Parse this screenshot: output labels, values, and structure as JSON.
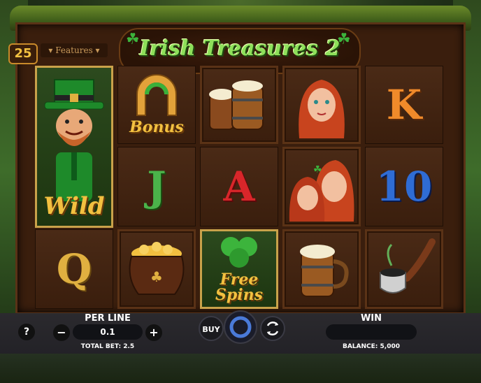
{
  "game": {
    "title": "Irish Treasures 2",
    "lines": "25",
    "features_label": "▾ Features ▾"
  },
  "reels": [
    [
      {
        "kind": "wild",
        "label": "Wild"
      },
      {
        "kind": "letter",
        "label": "Q"
      }
    ],
    [
      {
        "kind": "bonus",
        "label": "Bonus"
      },
      {
        "kind": "letter",
        "label": "J"
      },
      {
        "kind": "pot",
        "label": ""
      }
    ],
    [
      {
        "kind": "mugs",
        "label": ""
      },
      {
        "kind": "letter",
        "label": "A"
      },
      {
        "kind": "freespins",
        "label": "Free Spins"
      }
    ],
    [
      {
        "kind": "girl",
        "label": ""
      },
      {
        "kind": "girls",
        "label": ""
      },
      {
        "kind": "mug",
        "label": ""
      }
    ],
    [
      {
        "kind": "letter",
        "label": "K"
      },
      {
        "kind": "letter",
        "label": "10"
      },
      {
        "kind": "pipe",
        "label": ""
      }
    ]
  ],
  "controls": {
    "help_label": "?",
    "per_line_label": "PER LINE",
    "per_line_value": "0.1",
    "minus_label": "−",
    "plus_label": "+",
    "total_bet_label": "TOTAL BET: 2.5",
    "buy_label": "BUY",
    "win_label": "WIN",
    "win_value": "",
    "balance_label": "BALANCE: 5,000"
  },
  "colors": {
    "title_green": "#8ee05a",
    "gold": "#f2c040",
    "letter_J": "#4bb34a",
    "letter_A": "#d8262a",
    "letter_K": "#f08a2a",
    "letter_10": "#2f6cd4",
    "letter_Q": "#e0b040",
    "spin_ring": "#4a7ad8"
  }
}
